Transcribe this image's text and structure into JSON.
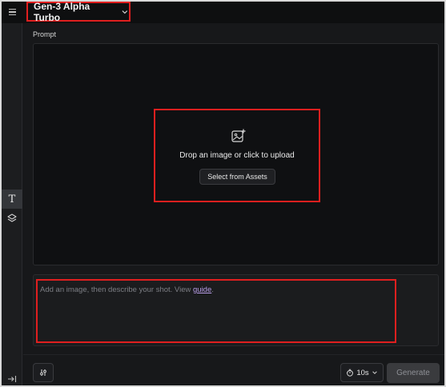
{
  "header": {
    "model_name": "Gen-3 Alpha Turbo"
  },
  "icons": {
    "menu": "hamburger-menu-icon",
    "chevron": "chevron-down-icon",
    "text_tool": "T",
    "layers": "layers-icon",
    "collapse": "collapse-sidebar-icon",
    "upload": "image-plus-icon",
    "settings": "settings-sliders-icon",
    "timer": "timer-icon"
  },
  "prompt": {
    "label": "Prompt",
    "drop_text": "Drop an image or click to upload",
    "assets_button": "Select from Assets",
    "placeholder_text": "Add an image, then describe your shot. View ",
    "guide_link": "guide",
    "placeholder_end": "."
  },
  "footer": {
    "duration": "10s",
    "generate_label": "Generate"
  },
  "colors": {
    "background": "#17181a",
    "highlight_box": "#e01f1f",
    "link": "#b79ce6",
    "generate_disabled": "#3a3b3e"
  }
}
